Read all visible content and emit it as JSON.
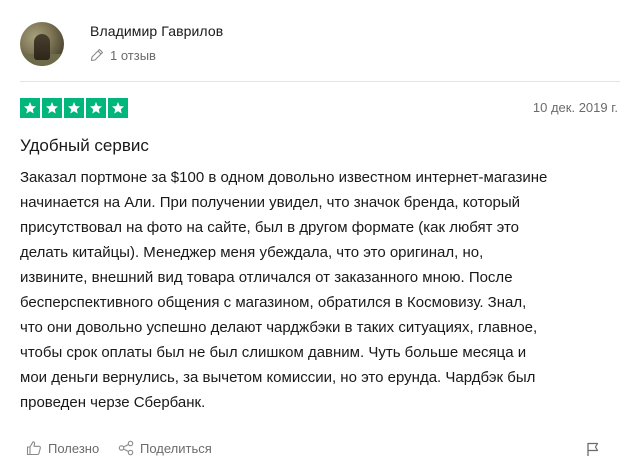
{
  "review": {
    "author": {
      "name": "Владимир Гаврилов",
      "reviews_count": "1 отзыв",
      "icons": {
        "avatar": "avatar-photo",
        "reviews": "pencil-icon"
      }
    },
    "rating": {
      "stars": 5,
      "max": 5,
      "color": "#00b67a"
    },
    "date": "10 дек. 2019 г.",
    "title": "Удобный сервис",
    "body_lines": [
      "Заказал портмоне за $100 в одном довольно известном интернет-магазине",
      "начинается на Али. При получении увидел, что значок бренда, который",
      "присутствовал на фото на сайте, был в другом формате (как любят это",
      "делать китайцы). Менеджер меня убеждала, что это оригинал, но,",
      "извините, внешний вид товара отличался от заказанного мною. После",
      "бесперспективного общения с магазином, обратился в Космовизу. Знал,",
      "что они довольно успешно делают чарджбэки в таких ситуациях, главное,",
      "чтобы срок оплаты был не был слишком давним. Чуть больше месяца и",
      "мои деньги вернулись, за вычетом комиссии, но это ерунда. Чардбэк был",
      "проведен черзе Сбербанк."
    ],
    "actions": {
      "useful_label": "Полезно",
      "share_label": "Поделиться",
      "icons": {
        "useful": "thumbs-up-icon",
        "share": "share-icon",
        "report": "flag-icon"
      }
    }
  }
}
